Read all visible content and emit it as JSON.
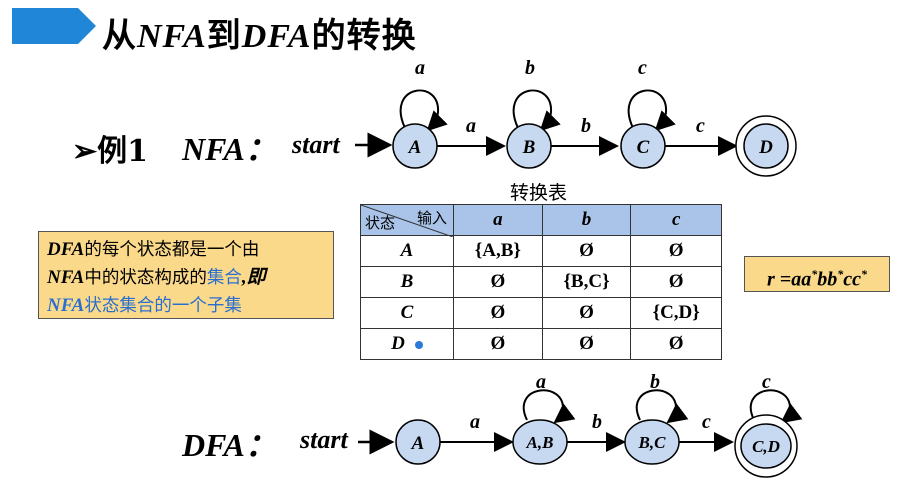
{
  "title": {
    "prefix": "从",
    "nfa": "NFA",
    "mid": "到",
    "dfa": "DFA",
    "suffix": "的转换"
  },
  "example": {
    "label": "➢例1",
    "nfa_label": "NFA：",
    "start_label": "start"
  },
  "nfa_diagram": {
    "states": [
      "A",
      "B",
      "C",
      "D"
    ],
    "accepting": [
      "D"
    ],
    "self_loops": [
      "a",
      "b",
      "c"
    ],
    "edges": [
      "a",
      "b",
      "c"
    ]
  },
  "table": {
    "caption": "转换表",
    "corner_input": "输入",
    "corner_state": "状态",
    "columns": [
      "a",
      "b",
      "c"
    ],
    "rows": [
      {
        "state": "A",
        "cells": [
          "{A,B}",
          "Ø",
          "Ø"
        ]
      },
      {
        "state": "B",
        "cells": [
          "Ø",
          "{B,C}",
          "Ø"
        ]
      },
      {
        "state": "C",
        "cells": [
          "Ø",
          "Ø",
          "{C,D}"
        ]
      },
      {
        "state": "D",
        "cells": [
          "Ø",
          "Ø",
          "Ø"
        ]
      }
    ]
  },
  "note": {
    "line1_dfa": "DFA",
    "line1_text": "的每个状态都是一个由",
    "line2_nfa": "NFA",
    "line2_text": "中的状态构成的",
    "line2_blue": "集合",
    "line2_end": ",即",
    "line3_nfa": "NFA",
    "line3_text": "状态集合的一个子集"
  },
  "regex": {
    "r": "r =aa",
    "s1": "*",
    "bb": "bb",
    "s2": "*",
    "cc": "cc",
    "s3": "*"
  },
  "dfa": {
    "label": "DFA：",
    "start_label": "start",
    "states": [
      "A",
      "A,B",
      "B,C",
      "C,D"
    ],
    "accepting": [
      "C,D"
    ],
    "self_loops": [
      "a",
      "b",
      "c"
    ],
    "edges": [
      "a",
      "b",
      "c"
    ]
  },
  "colors": {
    "state_fill": "#c6d9f1",
    "title_bar": "#1f86d8",
    "note_bg": "#fbd98a",
    "table_header": "#a9c4e8"
  }
}
